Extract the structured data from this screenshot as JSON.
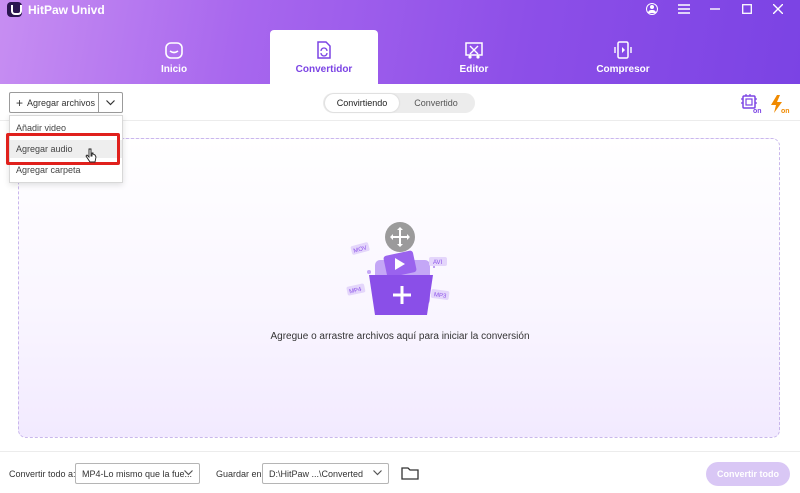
{
  "app": {
    "title": "HitPaw Univd"
  },
  "tabs": [
    {
      "label": "Inicio",
      "icon": "home-icon"
    },
    {
      "label": "Convertidor",
      "icon": "convert-icon",
      "active": true
    },
    {
      "label": "Editor",
      "icon": "editor-icon"
    },
    {
      "label": "Compresor",
      "icon": "compress-icon"
    }
  ],
  "toolbar": {
    "add_files_label": "Agregar archivos",
    "segments": [
      "Convirtiendo",
      "Convertido"
    ],
    "active_segment": "Convirtiendo"
  },
  "dropdown": {
    "items": [
      "Añadir video",
      "Agregar audio",
      "Agregar carpeta"
    ],
    "hovered": "Agregar audio"
  },
  "dropzone": {
    "prompt": "Agregue o arrastre archivos aquí para iniciar la conversión",
    "format_tags": [
      "MOV",
      "AVI",
      "MP4",
      "MP3"
    ]
  },
  "bottom": {
    "convert_all_label": "Convertir todo a:",
    "format_value": "MP4-Lo mismo que la fue...",
    "save_label": "Guardar en:",
    "path_value": "D:\\HitPaw ...\\Converted",
    "convert_button": "Convertir todo"
  },
  "colors": {
    "accent": "#7b43e4",
    "header_start": "#c78ef2",
    "highlight": "#e0201c",
    "button_disabled": "#d9c7f5"
  }
}
